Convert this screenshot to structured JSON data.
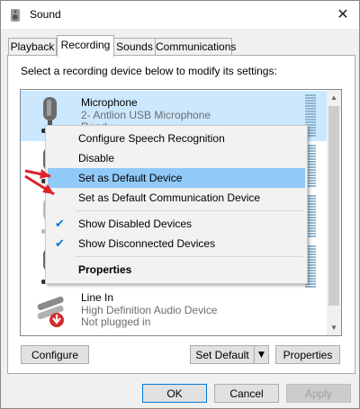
{
  "window": {
    "title": "Sound",
    "close_glyph": "✕"
  },
  "tabs": [
    {
      "label": "Playback"
    },
    {
      "label": "Recording"
    },
    {
      "label": "Sounds"
    },
    {
      "label": "Communications"
    }
  ],
  "panel": {
    "instruction": "Select a recording device below to modify its settings:"
  },
  "devices": [
    {
      "name": "Microphone",
      "sub": "2- Antlion USB Microphone",
      "status": "Ready",
      "icon": "microphone-icon"
    },
    {
      "name": "",
      "sub": "",
      "status": "",
      "icon": "microphone-icon"
    },
    {
      "name": "",
      "sub": "",
      "status": "",
      "icon": "microphone-icon"
    },
    {
      "name": "",
      "sub": "",
      "status": "",
      "icon": "microphone-icon"
    },
    {
      "name": "Line In",
      "sub": "High Definition Audio Device",
      "status": "Not plugged in",
      "icon": "line-in-icon"
    }
  ],
  "context_menu": {
    "items": [
      {
        "label": "Configure Speech Recognition"
      },
      {
        "label": "Disable"
      },
      {
        "label": "Set as Default Device"
      },
      {
        "label": "Set as Default Communication Device"
      },
      {
        "label": "Show Disabled Devices",
        "checked": true
      },
      {
        "label": "Show Disconnected Devices",
        "checked": true
      },
      {
        "label": "Properties"
      }
    ],
    "check_glyph": "✔"
  },
  "panel_buttons": {
    "configure": "Configure",
    "set_default": "Set Default",
    "properties": "Properties"
  },
  "dialog_buttons": {
    "ok": "OK",
    "cancel": "Cancel",
    "apply": "Apply"
  },
  "colors": {
    "accent": "#0078d7",
    "selection": "#cce8ff",
    "menu_highlight": "#91c9f7",
    "annotation_arrow": "#e0212a"
  }
}
